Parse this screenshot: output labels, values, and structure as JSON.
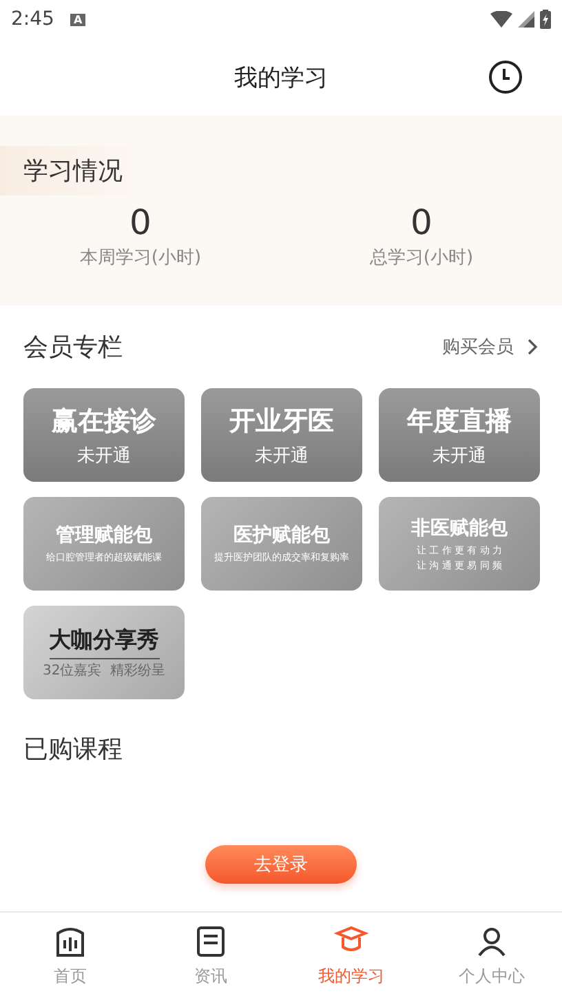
{
  "status_bar": {
    "time": "2:45",
    "notification": "A"
  },
  "header": {
    "title": "我的学习"
  },
  "study": {
    "title": "学习情况",
    "stats": [
      {
        "value": "0",
        "label": "本周学习(小时)"
      },
      {
        "value": "0",
        "label": "总学习(小时)"
      }
    ]
  },
  "membership": {
    "title": "会员专栏",
    "link": "购买会员",
    "cards": [
      {
        "kind": "basic",
        "title": "赢在接诊",
        "lines": [
          "未开通"
        ]
      },
      {
        "kind": "basic",
        "title": "开业牙医",
        "lines": [
          "未开通"
        ]
      },
      {
        "kind": "basic",
        "title": "年度直播",
        "lines": [
          "未开通"
        ]
      },
      {
        "kind": "package",
        "title": "管理赋能包",
        "lines": [
          "给口腔管理者的超级赋能课"
        ]
      },
      {
        "kind": "package",
        "title": "医护赋能包",
        "lines": [
          "提升医护团队的成交率和复购率"
        ]
      },
      {
        "kind": "package",
        "title": "非医赋能包",
        "lines": [
          "让 工 作 更 有 动 力",
          "让 沟 通 更 易 同 频"
        ]
      },
      {
        "kind": "showcase",
        "title": "大咖分享秀",
        "lines": [
          "32位嘉宾  精彩纷呈"
        ]
      }
    ]
  },
  "courses": {
    "title": "已购课程"
  },
  "login_button": "去登录",
  "tab_bar": [
    {
      "label": "首页",
      "selected": false
    },
    {
      "label": "资讯",
      "selected": false
    },
    {
      "label": "我的学习",
      "selected": true
    },
    {
      "label": "个人中心",
      "selected": false
    }
  ]
}
